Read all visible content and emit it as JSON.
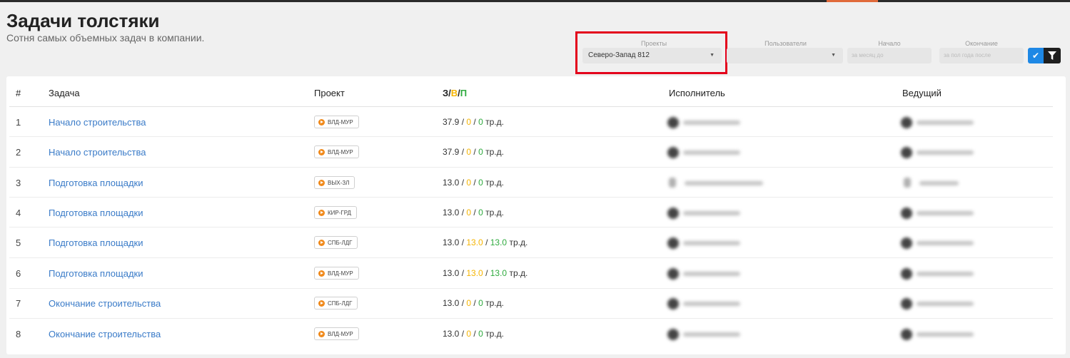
{
  "page": {
    "title": "Задачи толстяки",
    "subtitle": "Сотня самых объемных задач в компании."
  },
  "filters": {
    "projects_label": "Проекты",
    "projects_value": "Северо-Запад 812",
    "users_label": "Пользователи",
    "start_label": "Начало",
    "start_placeholder": "за месяц до",
    "end_label": "Окончание",
    "end_placeholder": "за пол года после"
  },
  "table": {
    "headers": {
      "num": "#",
      "task": "Задача",
      "project": "Проект",
      "time_z": "З",
      "time_sep": "/",
      "time_v": "В",
      "time_p": "П",
      "assignee": "Исполнитель",
      "lead": "Ведущий"
    },
    "rows": [
      {
        "num": "1",
        "task": "Начало строительства",
        "project": "ВЛД-МУР",
        "z": "37.9",
        "v": "0",
        "p": "0",
        "unit": "тр.д."
      },
      {
        "num": "2",
        "task": "Начало строительства",
        "project": "ВЛД-МУР",
        "z": "37.9",
        "v": "0",
        "p": "0",
        "unit": "тр.д."
      },
      {
        "num": "3",
        "task": "Подготовка площадки",
        "project": "ВЫХ-ЗЛ",
        "z": "13.0",
        "v": "0",
        "p": "0",
        "unit": "тр.д."
      },
      {
        "num": "4",
        "task": "Подготовка площадки",
        "project": "КИР-ГРД",
        "z": "13.0",
        "v": "0",
        "p": "0",
        "unit": "тр.д."
      },
      {
        "num": "5",
        "task": "Подготовка площадки",
        "project": "СПБ-ЛДГ",
        "z": "13.0",
        "v": "13.0",
        "p": "13.0",
        "unit": "тр.д."
      },
      {
        "num": "6",
        "task": "Подготовка площадки",
        "project": "ВЛД-МУР",
        "z": "13.0",
        "v": "13.0",
        "p": "13.0",
        "unit": "тр.д."
      },
      {
        "num": "7",
        "task": "Окончание строительства",
        "project": "СПБ-ЛДГ",
        "z": "13.0",
        "v": "0",
        "p": "0",
        "unit": "тр.д."
      },
      {
        "num": "8",
        "task": "Окончание строительства",
        "project": "ВЛД-МУР",
        "z": "13.0",
        "v": "0",
        "p": "0",
        "unit": "тр.д."
      }
    ]
  },
  "colors": {
    "accent_blue": "#1e88e5",
    "link": "#3a7bc8",
    "project_dot": "#f08a1c",
    "value_yellow": "#f5b400",
    "value_green": "#2eaa3e",
    "highlight_red": "#e3001b"
  },
  "icons": {
    "check": "check-icon",
    "filter": "filter-icon",
    "project_badge": "play-circle-icon",
    "dropdown": "caret-down-icon"
  }
}
